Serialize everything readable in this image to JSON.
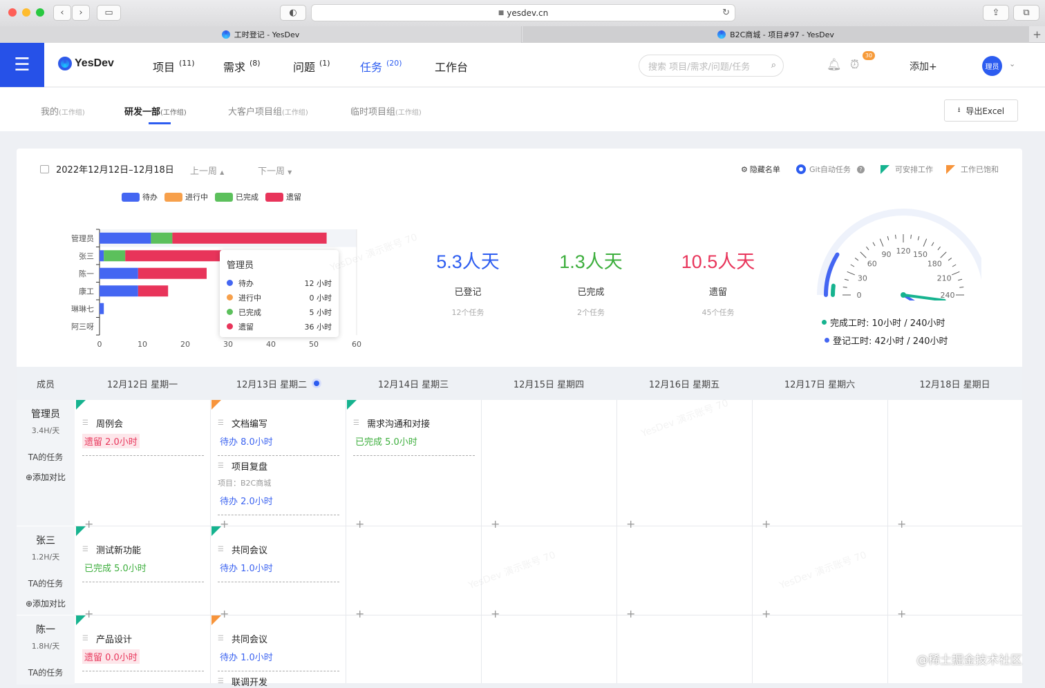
{
  "browser": {
    "url": "yesdev.cn",
    "tabs": [
      {
        "title": "工时登记 - YesDev"
      },
      {
        "title": "B2C商城 - 项目#97 - YesDev"
      }
    ]
  },
  "header": {
    "logo": "YesDev",
    "nav": [
      {
        "label": "项目",
        "count": "(11)"
      },
      {
        "label": "需求",
        "count": "(8)"
      },
      {
        "label": "问题",
        "count": "(1)"
      },
      {
        "label": "任务",
        "count": "(20)"
      },
      {
        "label": "工作台",
        "count": ""
      }
    ],
    "search_placeholder": "搜索 项目/需求/问题/任务",
    "alarm_badge": "30",
    "add_label": "添加+",
    "avatar_label": "理员"
  },
  "group_tabs": [
    {
      "label": "我的",
      "tag": "(工作组)"
    },
    {
      "label": "研发一部",
      "tag": "(工作组)"
    },
    {
      "label": "大客户项目组",
      "tag": "(工作组)"
    },
    {
      "label": "临时项目组",
      "tag": "(工作组)"
    }
  ],
  "export_label": "导出Excel",
  "toolbar": {
    "date_range": "2022年12月12日–12月18日",
    "prev_week": "上一周",
    "next_week": "下一周",
    "hide_list": "隐藏名单",
    "git_auto": "Git自动任务",
    "can_schedule": "可安排工作",
    "saturated": "工作已饱和"
  },
  "colors": {
    "todo": "#4466f2",
    "doing": "#f7a04b",
    "done": "#5cc05c",
    "left": "#e8345a",
    "brand": "#2651e8"
  },
  "chart_data": {
    "type": "bar",
    "orientation": "horizontal",
    "stacked": true,
    "categories": [
      "管理员",
      "张三",
      "陈一",
      "康工",
      "琳琳七",
      "阿三呀"
    ],
    "series": [
      {
        "name": "待办",
        "values": [
          12,
          1,
          9,
          9,
          1,
          0
        ]
      },
      {
        "name": "进行中",
        "values": [
          0,
          0,
          0,
          0,
          0,
          0
        ]
      },
      {
        "name": "已完成",
        "values": [
          5,
          5,
          0,
          0,
          0,
          0
        ]
      },
      {
        "name": "遗留",
        "values": [
          36,
          23,
          16,
          7,
          0,
          0
        ]
      }
    ],
    "xlim": [
      0,
      60
    ],
    "xticks": [
      0,
      10,
      20,
      30,
      40,
      50,
      60
    ],
    "legend_position": "top-left",
    "grid": false
  },
  "tooltip": {
    "title": "管理员",
    "rows": [
      {
        "name": "待办",
        "value": "12 小时"
      },
      {
        "name": "进行中",
        "value": "0 小时"
      },
      {
        "name": "已完成",
        "value": "5 小时"
      },
      {
        "name": "遗留",
        "value": "36 小时"
      }
    ]
  },
  "stats": [
    {
      "value": "5.3人天",
      "label": "已登记",
      "sub": "12个任务",
      "color": "#2c5cf0"
    },
    {
      "value": "1.3人天",
      "label": "已完成",
      "sub": "2个任务",
      "color": "#3cae3c"
    },
    {
      "value": "10.5人天",
      "label": "遗留",
      "sub": "45个任务",
      "color": "#e8345a"
    }
  ],
  "gauge": {
    "ticks": [
      "0",
      "30",
      "60",
      "90",
      "120",
      "150",
      "180",
      "210",
      "240"
    ],
    "max": 240,
    "done_hours": 10,
    "logged_hours": 42,
    "done_label": "完成工时:",
    "done_value": "10小时 / 240小时",
    "logged_label": "登记工时:",
    "logged_value": "42小时 / 240小时"
  },
  "calendar": {
    "member_header": "成员",
    "days": [
      "12月12日 星期一",
      "12月13日 星期二",
      "12月14日 星期三",
      "12月15日 星期四",
      "12月16日 星期五",
      "12月17日 星期六",
      "12月18日 星期日"
    ],
    "members": [
      {
        "name": "管理员",
        "rate": "3.4H/天",
        "ta": "TA的任务",
        "add": "添加对比"
      },
      {
        "name": "张三",
        "rate": "1.2H/天",
        "ta": "TA的任务",
        "add": "添加对比"
      },
      {
        "name": "陈一",
        "rate": "1.8H/天",
        "ta": "TA的任务",
        "add": ""
      }
    ],
    "tasks": {
      "t1": {
        "title": "周例会",
        "status": "遗留 2.0小时"
      },
      "t2": {
        "title": "文档编写",
        "status": "待办 8.0小时"
      },
      "t3": {
        "title": "项目复盘",
        "project": "项目：B2C商城",
        "status": "待办 2.0小时"
      },
      "t4": {
        "title": "需求沟通和对接",
        "status": "已完成 5.0小时"
      },
      "t5": {
        "title": "测试新功能",
        "status": "已完成 5.0小时"
      },
      "t6": {
        "title": "共同会议",
        "status": "待办 1.0小时"
      },
      "t7": {
        "title": "产品设计",
        "status": "遗留 0.0小时"
      },
      "t8": {
        "title": "共同会议",
        "status": "待办 1.0小时"
      },
      "t9": {
        "title": "联调开发"
      }
    }
  },
  "watermark": "YesDev 演示账号 70",
  "credit": "@稀土掘金技术社区"
}
